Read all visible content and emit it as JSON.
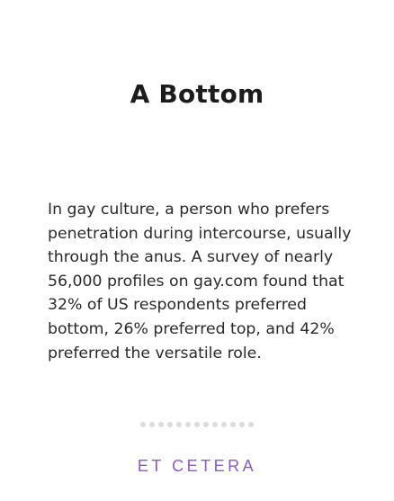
{
  "card": {
    "title": "A Bottom",
    "definition": "In gay culture, a person who prefers penetration during intercourse, usually through the anus. A survey of nearly 56,000 profiles on gay.com found that 32% of US respondents preferred bottom, 26% preferred top, and 42% preferred the versatile role."
  },
  "pager": {
    "dot_count": 13,
    "dot_color": "#dcdcdc"
  },
  "footer": {
    "brand": "ET CETERA",
    "brand_color": "#8a5bc7"
  }
}
